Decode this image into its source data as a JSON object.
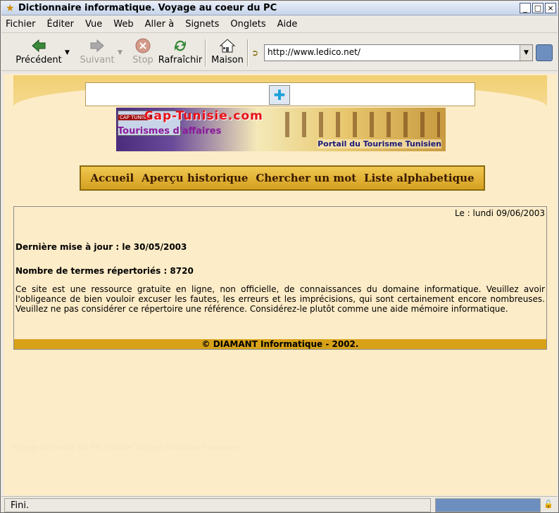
{
  "window": {
    "title": "Dictionnaire informatique. Voyage au coeur du PC"
  },
  "menu": [
    "Fichier",
    "Éditer",
    "Vue",
    "Web",
    "Aller à",
    "Signets",
    "Onglets",
    "Aide"
  ],
  "toolbar": {
    "back": "Précédent",
    "forward": "Suivant",
    "stop": "Stop",
    "reload": "Rafraîchir",
    "home": "Maison"
  },
  "url": "http://www.ledico.net/",
  "ad": {
    "title": "Cap-Tunisie.com",
    "left": "Tourismes d'affaires",
    "right": "Portail du Tourisme Tunisien",
    "thumb": "CAP TUNISIE"
  },
  "nav": [
    "Accueil",
    "Aperçu historique",
    "Chercher un mot",
    "Liste alphabetique"
  ],
  "main": {
    "date": "Le : lundi 09/06/2003",
    "update": "Dernière mise à jour : le 30/05/2003",
    "count": "Nombre de termes répertoriés : 8720",
    "text": "Ce site est une ressource gratuite en ligne, non officielle, de connaissances du domaine informatique. Veuillez avoir l'obligeance de bien vouloir excuser les fautes, les erreurs et les imprécisions, qui sont certainement encore nombreuses. Veuillez ne pas considérer ce répertoire une référence. Considérez-le plutôt comme une aide mémoire informatique.",
    "footer": "© DIAMANT Informatique - 2002."
  },
  "hidden_text": "Voyage au coeur du PC  Tunisie  Voyage tourisme vacances",
  "status": "Fini."
}
